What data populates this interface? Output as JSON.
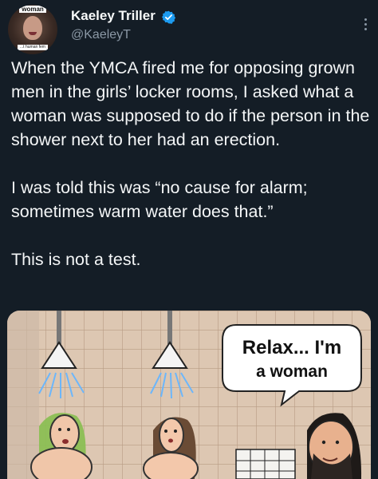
{
  "author": {
    "display_name": "Kaeley Triller",
    "handle": "@KaeleyT",
    "avatar_label_top": "woman",
    "avatar_label_bottom": "...t human fem"
  },
  "tweet": {
    "paragraphs": [
      "When the YMCA fired me for opposing grown men in the girls’ locker rooms, I asked what a woman was supposed to do if the person in the shower next to her had an erection.",
      "I was told this was “no cause for alarm; sometimes warm water does that.”",
      "This is not a test."
    ]
  },
  "media": {
    "speech_bubble_line1": "Relax... I'm",
    "speech_bubble_line2": "a woman"
  },
  "colors": {
    "background": "#141d26",
    "text": "#f4f6f7",
    "muted": "#8b98a5",
    "verified": "#1d9bf0"
  },
  "icons": {
    "verified": "verified-badge-icon",
    "more": "more-options-icon"
  }
}
